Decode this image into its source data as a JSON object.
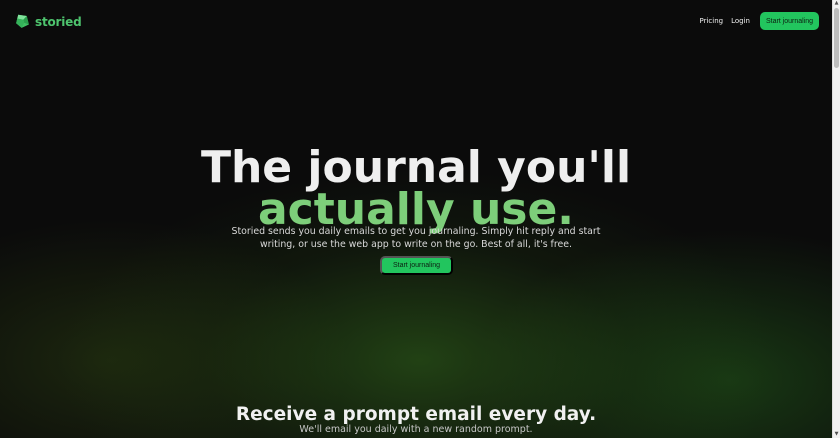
{
  "header": {
    "brand": "storied",
    "nav": {
      "pricing": "Pricing",
      "login": "Login",
      "cta": "Start journaling"
    }
  },
  "hero": {
    "line1": "The journal you'll",
    "line2": "actually use.",
    "subtitle": "Storied sends you daily emails to get you journaling. Simply hit reply and start writing, or use the web app to write on the go. Best of all, it's free.",
    "cta": "Start journaling"
  },
  "section": {
    "title": "Receive a prompt email every day.",
    "subtitle": "We'll email you daily with a new random prompt."
  },
  "icons": {
    "logo": "storied-logo-icon",
    "scroll_up": "scroll-up-arrow-icon",
    "scroll_down": "scroll-down-arrow-icon"
  },
  "colors": {
    "accent": "#22c55e",
    "brand_text": "#4ec46e",
    "hero_highlight": "#7dce7a",
    "background": "#0b0b0b"
  }
}
